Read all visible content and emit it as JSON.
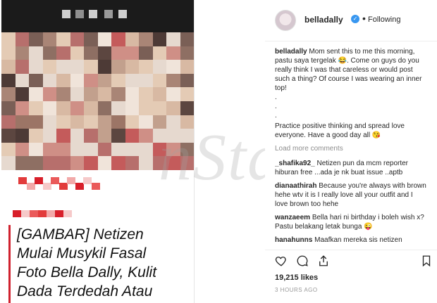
{
  "article": {
    "headline_lines": [
      "[GAMBAR] Netizen",
      "Mulai Musykil Fasal",
      "Foto Bella Dally, Kulit",
      "Dada Terdedah Atau"
    ]
  },
  "watermark": "nStar",
  "post": {
    "username": "belladally",
    "follow_status": "Following",
    "caption_user": "belladally",
    "caption_lines": [
      "Mom sent this to me this morning, pastu saya tergelak 😂. Come on guys do you really think I was that careless or would post such a thing? Of course I was wearing an inner top!",
      ".",
      ".",
      ".",
      "Practice positive thinking and spread love everyone. Have a good day all 😘"
    ],
    "load_more": "Load more comments",
    "comments": [
      {
        "user": "_shafika92_",
        "text": "Netizen pun da mcm reporter hiburan free ...ada je nk buat issue ..aptb"
      },
      {
        "user": "dianaathirah",
        "text": "Because you're always with brown hehe wtv it is I really love all your outfit and I love brown too hehe"
      },
      {
        "user": "wanzaeem",
        "text": "Bella hari ni birthday i boleh wish x? Pastu belakang letak bunga 😜"
      },
      {
        "user": "hanahunns",
        "text": "Maafkan mereka sis netizen"
      }
    ],
    "likes": "19,215 likes",
    "time_ago": "3 HOURS AGO"
  },
  "icons": [
    "heart-icon",
    "comment-icon",
    "share-icon",
    "bookmark-icon",
    "verified-icon"
  ],
  "colors": {
    "accent_red": "#d0212e",
    "verified_blue": "#3897f0",
    "text": "#262626",
    "muted": "#8e8e8e"
  }
}
